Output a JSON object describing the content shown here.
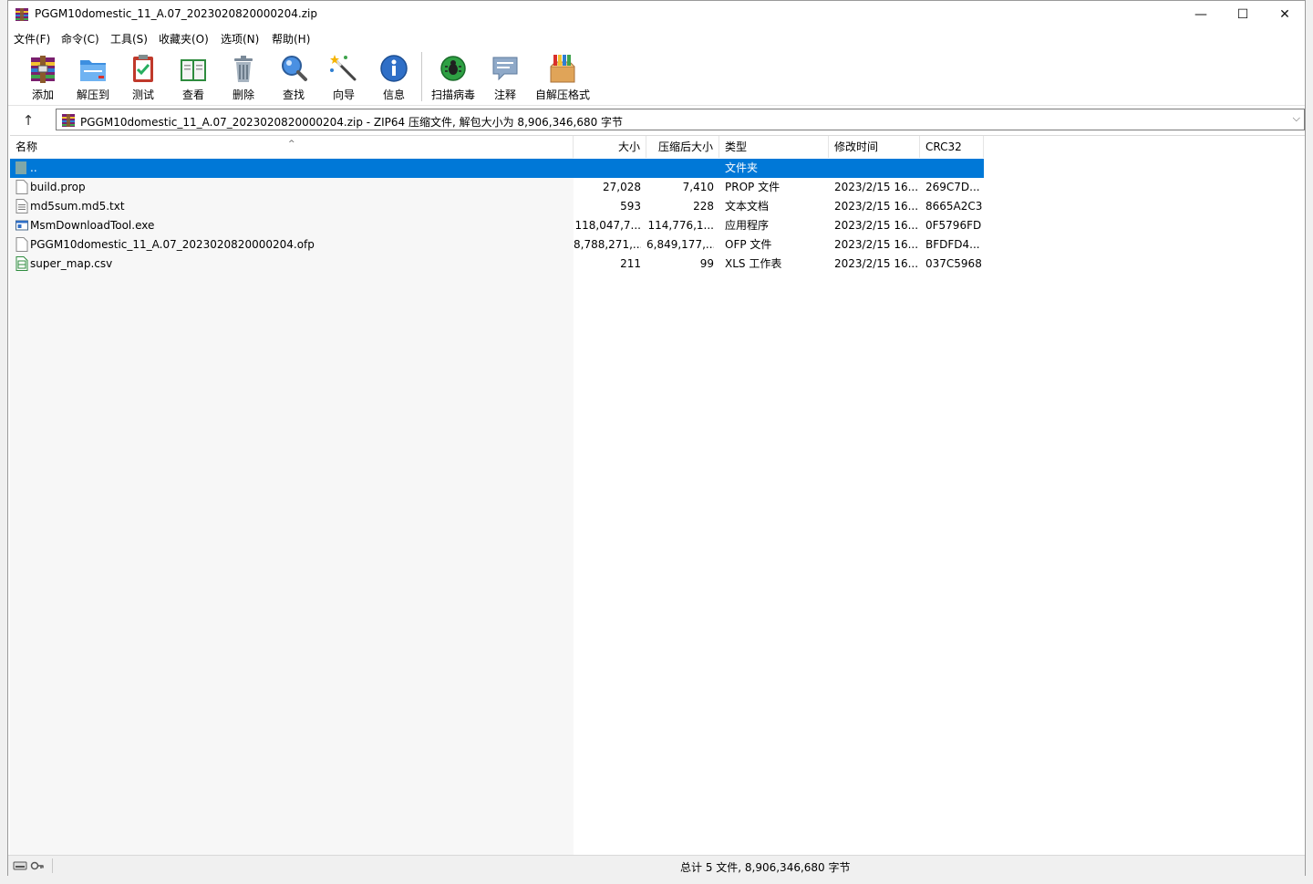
{
  "window": {
    "title": "PGGM10domestic_11_A.07_2023020820000204.zip",
    "minimize_glyph": "—",
    "maximize_glyph": "☐",
    "close_glyph": "✕"
  },
  "menu": [
    "文件(F)",
    "命令(C)",
    "工具(S)",
    "收藏夹(O)",
    "选项(N)",
    "帮助(H)"
  ],
  "toolbar": [
    {
      "label": "添加",
      "icon": "add-archive-icon"
    },
    {
      "label": "解压到",
      "icon": "extract-folder-icon"
    },
    {
      "label": "测试",
      "icon": "test-clipboard-icon"
    },
    {
      "label": "查看",
      "icon": "view-book-icon"
    },
    {
      "label": "删除",
      "icon": "trash-icon"
    },
    {
      "label": "查找",
      "icon": "magnifier-icon"
    },
    {
      "label": "向导",
      "icon": "wizard-wand-icon"
    },
    {
      "label": "信息",
      "icon": "info-icon"
    },
    {
      "label": "扫描病毒",
      "icon": "virus-scan-icon"
    },
    {
      "label": "注释",
      "icon": "comment-icon"
    },
    {
      "label": "自解压格式",
      "icon": "sfx-box-icon"
    }
  ],
  "address": {
    "up_glyph": "↑",
    "text": "PGGM10domestic_11_A.07_2023020820000204.zip - ZIP64 压缩文件, 解包大小为 8,906,346,680 字节",
    "dropdown_glyph": "⌵"
  },
  "columns": {
    "name": "名称",
    "size": "大小",
    "packed": "压缩后大小",
    "type": "类型",
    "modified": "修改时间",
    "crc": "CRC32",
    "sort_glyph": "^"
  },
  "files": [
    {
      "name": "..",
      "size": "",
      "packed": "",
      "type": "文件夹",
      "modified": "",
      "crc": "",
      "icon": "parent-folder-icon",
      "selected": true
    },
    {
      "name": "build.prop",
      "size": "27,028",
      "packed": "7,410",
      "type": "PROP 文件",
      "modified": "2023/2/15 16...",
      "crc": "269C7D...",
      "icon": "file-icon",
      "selected": false
    },
    {
      "name": "md5sum.md5.txt",
      "size": "593",
      "packed": "228",
      "type": "文本文档",
      "modified": "2023/2/15 16...",
      "crc": "8665A2C3",
      "icon": "text-file-icon",
      "selected": false
    },
    {
      "name": "MsmDownloadTool.exe",
      "size": "118,047,7...",
      "packed": "114,776,1...",
      "type": "应用程序",
      "modified": "2023/2/15 16...",
      "crc": "0F5796FD",
      "icon": "exe-icon",
      "selected": false
    },
    {
      "name": "PGGM10domestic_11_A.07_2023020820000204.ofp",
      "size": "8,788,271,...",
      "packed": "6,849,177,...",
      "type": "OFP 文件",
      "modified": "2023/2/15 16...",
      "crc": "BFDFD4...",
      "icon": "file-icon",
      "selected": false
    },
    {
      "name": "super_map.csv",
      "size": "211",
      "packed": "99",
      "type": "XLS 工作表",
      "modified": "2023/2/15 16...",
      "crc": "037C5968",
      "icon": "csv-icon",
      "selected": false
    }
  ],
  "status": {
    "summary": "总计 5 文件, 8,906,346,680 字节"
  }
}
